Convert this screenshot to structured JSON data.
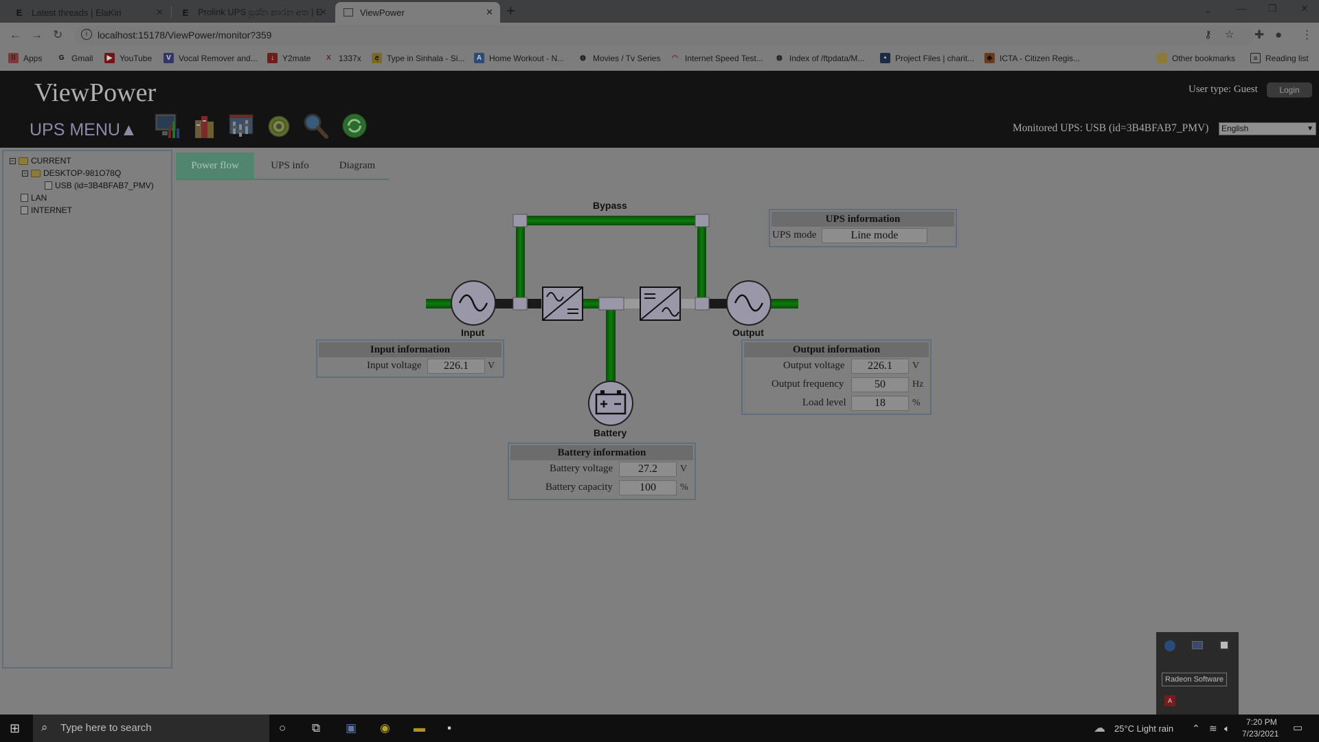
{
  "browser": {
    "tabs": [
      {
        "label": "Latest threads | ElaKiri",
        "favicon": "ElaKiri-logo-icon"
      },
      {
        "label": "Prolink UPS ප්‍රශ්න කාරන අත | ElaK",
        "favicon": "ElaKiri-logo-icon"
      },
      {
        "label": "ViewPower",
        "favicon": "viewpower-icon"
      }
    ],
    "url": "localhost:15178/ViewPower/monitor?359",
    "bookmarks": [
      "Apps",
      "Gmail",
      "YouTube",
      "Vocal Remover and...",
      "Y2mate",
      "1337x",
      "Type in Sinhala - Si...",
      "Home Workout - N...",
      "Movies / Tv Series",
      "Internet Speed Test...",
      "Index of /ftpdata/M...",
      "Project Files | charit...",
      "ICTA - Citizen Regis..."
    ],
    "other_bookmarks": "Other bookmarks",
    "reading_list": "Reading list"
  },
  "header": {
    "title": "ViewPower",
    "menu_label": "UPS MENU▲",
    "user_type": "User type: Guest",
    "login_label": "Login",
    "monitored": "Monitored UPS: USB (id=3B4BFAB7_PMV)",
    "language": "English",
    "icons": [
      "monitor-chart-icon",
      "data-log-icon",
      "ups-settings-icon",
      "control-gear-icon",
      "search-magnifier-icon",
      "refresh-icon"
    ]
  },
  "tree": {
    "current": "CURRENT",
    "desktop": "DESKTOP-981O78Q",
    "usb": "USB (id=3B4BFAB7_PMV)",
    "lan": "LAN",
    "internet": "INTERNET"
  },
  "tabs": [
    "Power flow",
    "UPS info",
    "Diagram"
  ],
  "diagram": {
    "bypass": "Bypass",
    "input": "Input",
    "output": "Output",
    "battery": "Battery",
    "flow_color": "#0b7a0b",
    "node_color": "#9a98a8"
  },
  "ups_info": {
    "title": "UPS information",
    "mode_label": "UPS mode",
    "mode_value": "Line mode"
  },
  "input_info": {
    "title": "Input information",
    "voltage_label": "Input voltage",
    "voltage_value": "226.1",
    "voltage_unit": "V"
  },
  "output_info": {
    "title": "Output information",
    "voltage_label": "Output voltage",
    "voltage_value": "226.1",
    "voltage_unit": "V",
    "freq_label": "Output frequency",
    "freq_value": "50",
    "freq_unit": "Hz",
    "load_label": "Load level",
    "load_value": "18",
    "load_unit": "%"
  },
  "battery_info": {
    "title": "Battery information",
    "voltage_label": "Battery voltage",
    "voltage_value": "27.2",
    "voltage_unit": "V",
    "capacity_label": "Battery capacity",
    "capacity_value": "100",
    "capacity_unit": "%"
  },
  "tray_popup": {
    "tooltip": "Radeon Software"
  },
  "taskbar": {
    "search_placeholder": "Type here to search",
    "weather": "25°C  Light rain",
    "time": "7:20 PM",
    "date": "7/23/2021"
  }
}
